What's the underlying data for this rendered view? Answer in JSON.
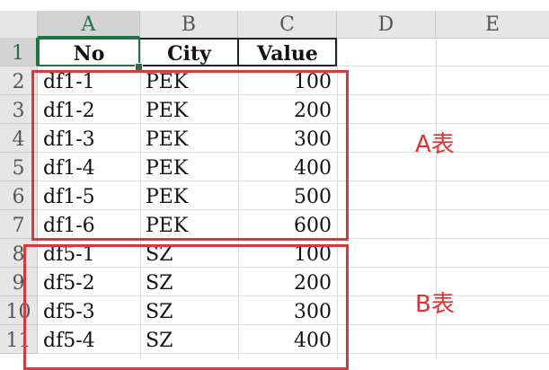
{
  "columns": [
    "A",
    "B",
    "C",
    "D",
    "E"
  ],
  "rows": [
    "1",
    "2",
    "3",
    "4",
    "5",
    "6",
    "7",
    "8",
    "9",
    "10",
    "11"
  ],
  "table": {
    "headers": [
      "No",
      "City",
      "Value"
    ],
    "rows": [
      [
        "df1-1",
        "PEK",
        "100"
      ],
      [
        "df1-2",
        "PEK",
        "200"
      ],
      [
        "df1-3",
        "PEK",
        "300"
      ],
      [
        "df1-4",
        "PEK",
        "400"
      ],
      [
        "df1-5",
        "PEK",
        "500"
      ],
      [
        "df1-6",
        "PEK",
        "600"
      ],
      [
        "df5-1",
        "SZ",
        "100"
      ],
      [
        "df5-2",
        "SZ",
        "200"
      ],
      [
        "df5-3",
        "SZ",
        "300"
      ],
      [
        "df5-4",
        "SZ",
        "400"
      ]
    ]
  },
  "annotations": {
    "group_a_label": "A表",
    "group_b_label": "B表"
  },
  "colors": {
    "annotation_red": "#d9393a",
    "selection_green": "#217346"
  }
}
